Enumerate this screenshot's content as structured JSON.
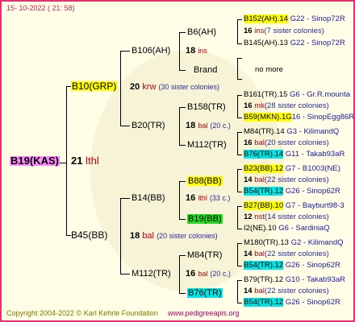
{
  "header": {
    "date": "15- 10-2022 ( 21: 58)"
  },
  "footer": {
    "copyright": "Copyright 2004-2022 © Karl Kehrle Foundation",
    "url": "www.pedigreeapis.org"
  },
  "root": {
    "name": "B19(KAS)",
    "num": "21",
    "tag": "lthl"
  },
  "sire": {
    "name": "B10(GRP)",
    "num": "20",
    "tag": "krw",
    "note": "(30 sister colonies)"
  },
  "dam": {
    "name": "B45(BB)",
    "num": "18",
    "tag": "bal",
    "note": "(20 sister colonies)"
  },
  "ss": {
    "name": "B106(AH)",
    "num": "18",
    "tag": "ins"
  },
  "sd": {
    "name": "B20(TR)",
    "num": "18",
    "tag": "bal",
    "note": "(20 c.)"
  },
  "ds": {
    "name": "B14(BB)",
    "num": "16",
    "tag": "lthl",
    "note": "(33 c.)"
  },
  "dd": {
    "name": "M112(TR)",
    "num": "16",
    "tag": "bal",
    "note": "(20 c.)"
  },
  "g3": [
    {
      "name": "B6(AH)"
    },
    {
      "name": "Brand"
    },
    {
      "name": "B158(TR)",
      "num": "18",
      "tag": "bal",
      "note": "(20 c.)"
    },
    {
      "name": "M112(TR)"
    },
    {
      "name": "B88(BB)",
      "num": "16",
      "tag": "lthl",
      "note": "(33 c.)"
    },
    {
      "name": "B19(BB)"
    },
    {
      "name": "M84(TR)",
      "num": "16",
      "tag": "bal",
      "note": "(20 c.)"
    },
    {
      "name": "B76(TR)"
    }
  ],
  "g4": [
    {
      "name": "B152(AH).14",
      "loc": "G22 - Sinop72R"
    },
    {
      "num": "16",
      "tag": "ins",
      "note": "(7 sister colonies)"
    },
    {
      "name": "B145(AH).13",
      "loc": "G22 - Sinop72R"
    },
    {
      "name": "no more"
    },
    {
      "name": "B161(TR).15",
      "loc": "G6 - Gr.R.mounta"
    },
    {
      "num": "16",
      "tag": "mk",
      "note": "(28 sister colonies)"
    },
    {
      "name": "B59(MKN).1G",
      "loc": "16 - SinopEgg86R"
    },
    {
      "name": "M84(TR).14",
      "loc": "G3 - KilimandQ"
    },
    {
      "num": "16",
      "tag": "bal",
      "note": "(20 sister colonies)"
    },
    {
      "name": "B76(TR).14",
      "loc": "G11 - Takab93aR"
    },
    {
      "name": "B23(BB).12",
      "loc": "G7 - B1003(NE)"
    },
    {
      "num": "14",
      "tag": "bal",
      "note": "(22 sister colonies)"
    },
    {
      "name": "B54(TR).12",
      "loc": "G26 - Sinop62R"
    },
    {
      "name": "B27(BB).10",
      "loc": "G7 - Bayburt98-3"
    },
    {
      "num": "12",
      "tag": "nst",
      "note": "(14 sister colonies)"
    },
    {
      "name": "I2(NE).10",
      "loc": "G6 - SardiniaQ"
    },
    {
      "name": "M180(TR).13",
      "loc": "G2 - KilimandQ"
    },
    {
      "num": "14",
      "tag": "bal",
      "note": "(22 sister colonies)"
    },
    {
      "name": "B54(TR).12",
      "loc": "G26 - Sinop62R"
    },
    {
      "name": "B79(TR).12",
      "loc": "G10 - Takab93aR"
    },
    {
      "num": "14",
      "tag": "bal",
      "note": "(22 sister colonies)"
    },
    {
      "name": "B54(TR).12",
      "loc": "G26 - Sinop62R"
    }
  ]
}
